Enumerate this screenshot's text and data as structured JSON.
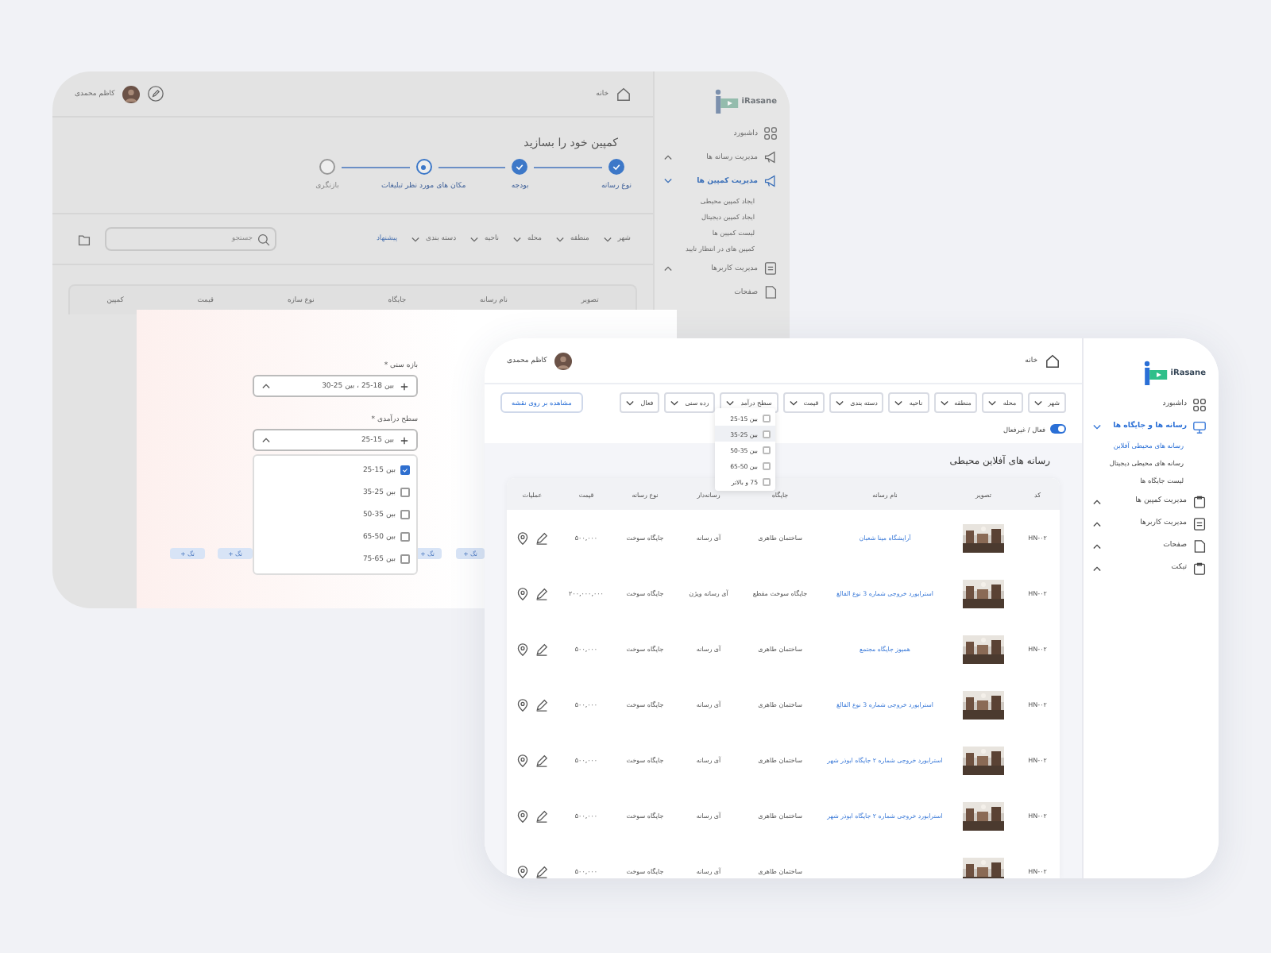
{
  "back_window": {
    "header": {
      "home": "خانه",
      "user": "کاظم محمدی"
    },
    "sidebar": {
      "logo": "iRasane",
      "items": [
        {
          "label": "داشبورد",
          "kind": "grid",
          "selected": false
        },
        {
          "label": "مدیریت رسانه ها",
          "kind": "megaphone",
          "selected": false,
          "expanded": false
        },
        {
          "label": "مدیریت کمپین ها",
          "kind": "megaphone",
          "selected": true,
          "expanded": true,
          "children": [
            {
              "label": "ایجاد کمپین محیطی",
              "selected": false
            },
            {
              "label": "ایجاد کمپین دیجیتال",
              "selected": false
            },
            {
              "label": "لیست کمپین ها",
              "selected": false
            },
            {
              "label": "کمپین های در انتظار تایید",
              "selected": false
            }
          ]
        },
        {
          "label": "مدیریت کاربرها",
          "kind": "note",
          "selected": false,
          "expanded": false
        },
        {
          "label": "صفحات",
          "kind": "page",
          "selected": false
        }
      ]
    },
    "title": "کمپین خود را بسازید",
    "stepper": [
      {
        "label": "نوع رسانه",
        "completed": true,
        "selected": false
      },
      {
        "label": "بودجه",
        "completed": true,
        "selected": false
      },
      {
        "label": "مکان های مورد نظر تبلیغات",
        "completed": false,
        "selected": true
      },
      {
        "label": "بازنگری",
        "completed": false,
        "selected": false
      }
    ],
    "filters": [
      {
        "label": "شهر",
        "kind": "select"
      },
      {
        "label": "منطقه",
        "kind": "select"
      },
      {
        "label": "محله",
        "kind": "select"
      },
      {
        "label": "ناحیه",
        "kind": "select"
      },
      {
        "label": "دسته بندی",
        "kind": "select"
      },
      {
        "label": "پیشنهاد",
        "kind": "link"
      }
    ],
    "search": {
      "placeholder": "جستجو"
    },
    "table": {
      "columns": [
        "تصویر",
        "نام رسانه",
        "جایگاه",
        "نوع سازه",
        "قیمت",
        "کمپین"
      ]
    }
  },
  "form_panel": {
    "fields": [
      {
        "label": "بازه سنی *",
        "value": "بین 18-25 ، بین 25-30"
      },
      {
        "label": "سطح درآمدی *",
        "value": "بین 15-25",
        "options": [
          {
            "label": "بین 15-25",
            "checked": true
          },
          {
            "label": "بین 25-35",
            "checked": false
          },
          {
            "label": "بین 35-50",
            "checked": false
          },
          {
            "label": "بین 50-65",
            "checked": false
          },
          {
            "label": "بین 65-75",
            "checked": false
          }
        ]
      }
    ],
    "tags": [
      "+ تگ",
      "+ تگ",
      "+ تگ",
      "+ تگ"
    ]
  },
  "front_window": {
    "header": {
      "home": "خانه",
      "user": "کاظم محمدی"
    },
    "sidebar": {
      "logo": "iRasane",
      "items": [
        {
          "label": "داشبورد",
          "kind": "grid",
          "selected": false
        },
        {
          "label": "رسانه ها و جایگاه ها",
          "kind": "monitor",
          "selected": true,
          "expanded": true,
          "children": [
            {
              "label": "رسانه های محیطی آفلاین",
              "selected": true
            },
            {
              "label": "رسانه های محیطی دیجیتال",
              "selected": false
            },
            {
              "label": "لیست جایگاه ها",
              "selected": false
            }
          ]
        },
        {
          "label": "مدیریت کمپین ها",
          "kind": "clipboard",
          "selected": false,
          "expanded": false
        },
        {
          "label": "مدیریت کاربرها",
          "kind": "note",
          "selected": false,
          "expanded": false
        },
        {
          "label": "صفحات",
          "kind": "page",
          "selected": false,
          "expanded": false
        },
        {
          "label": "تیکت",
          "kind": "clipboard",
          "selected": false,
          "expanded": false
        }
      ]
    },
    "filters": [
      "شهر",
      "محله",
      "منطقه",
      "ناحیه",
      "دسته بندی",
      "قیمت",
      "سطح درآمد",
      "رده سنی",
      "فعال"
    ],
    "filter_options": [
      {
        "label": "بین 15-25",
        "selected": false
      },
      {
        "label": "بین 25-35",
        "selected": true
      },
      {
        "label": "بین 35-50",
        "selected": false
      },
      {
        "label": "بین 50-65",
        "selected": false
      },
      {
        "label": "75 و بالاتر",
        "selected": false
      }
    ],
    "map_button": "مشاهده بر روی نقشه",
    "toggle": {
      "label": "فعال / غیرفعال",
      "on": true
    },
    "section_title": "رسانه های آفلاین محیطی",
    "table": {
      "columns": [
        "کد",
        "تصویر",
        "نام رسانه",
        "جایگاه",
        "رسانه‌دار",
        "نوع رسانه",
        "قیمت",
        "عملیات"
      ],
      "rows": [
        {
          "code": "HN-۰۲",
          "name": "آرایشگاه مینا شعبان",
          "place": "ساختمان طاهری",
          "owner": "آی رسانه",
          "type": "جایگاه سوخت",
          "price": "۵۰۰,۰۰۰"
        },
        {
          "code": "HN-۰۲",
          "name": "استرابورد خروجی شماره 3 نوع الفالغ",
          "place": "جایگاه سوخت مقطع",
          "owner": "آی رسانه ویژن",
          "type": "جایگاه سوخت",
          "price": "۲۰۰,۰۰۰,۰۰۰"
        },
        {
          "code": "HN-۰۲",
          "name": "همیوز جایگاه مجتمع",
          "place": "ساختمان طاهری",
          "owner": "آی رسانه",
          "type": "جایگاه سوخت",
          "price": "۵۰۰,۰۰۰"
        },
        {
          "code": "HN-۰۲",
          "name": "استرابورد خروجی شماره 3 نوع الفالغ",
          "place": "ساختمان طاهری",
          "owner": "آی رسانه",
          "type": "جایگاه سوخت",
          "price": "۵۰۰,۰۰۰"
        },
        {
          "code": "HN-۰۲",
          "name": "استرابورد خروجی شماره ۲ جایگاه ابوذر شهر",
          "place": "ساختمان طاهری",
          "owner": "آی رسانه",
          "type": "جایگاه سوخت",
          "price": "۵۰۰,۰۰۰"
        },
        {
          "code": "HN-۰۲",
          "name": "استرابورد خروجی شماره ۲ جایگاه ابوذر شهر",
          "place": "ساختمان طاهری",
          "owner": "آی رسانه",
          "type": "جایگاه سوخت",
          "price": "۵۰۰,۰۰۰"
        },
        {
          "code": "HN-۰۲",
          "place": "ساختمان طاهری",
          "owner": "آی رسانه",
          "type": "جایگاه سوخت",
          "price": "۵۰۰,۰۰۰"
        }
      ]
    }
  }
}
